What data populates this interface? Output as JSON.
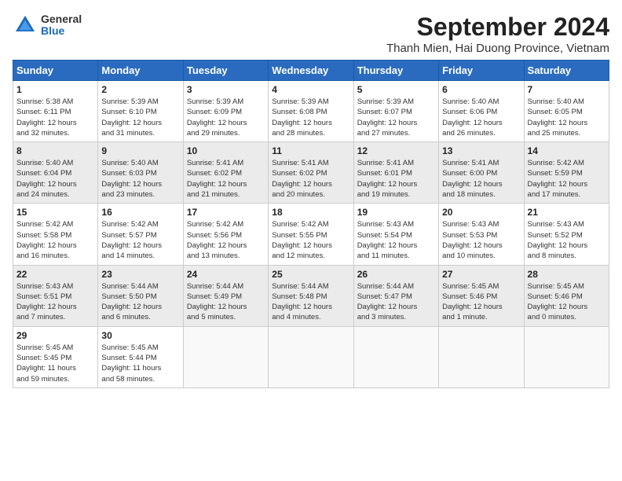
{
  "logo": {
    "general": "General",
    "blue": "Blue"
  },
  "title": "September 2024",
  "location": "Thanh Mien, Hai Duong Province, Vietnam",
  "days_header": [
    "Sunday",
    "Monday",
    "Tuesday",
    "Wednesday",
    "Thursday",
    "Friday",
    "Saturday"
  ],
  "weeks": [
    [
      {
        "num": "1",
        "lines": [
          "Sunrise: 5:38 AM",
          "Sunset: 6:11 PM",
          "Daylight: 12 hours",
          "and 32 minutes."
        ]
      },
      {
        "num": "2",
        "lines": [
          "Sunrise: 5:39 AM",
          "Sunset: 6:10 PM",
          "Daylight: 12 hours",
          "and 31 minutes."
        ]
      },
      {
        "num": "3",
        "lines": [
          "Sunrise: 5:39 AM",
          "Sunset: 6:09 PM",
          "Daylight: 12 hours",
          "and 29 minutes."
        ]
      },
      {
        "num": "4",
        "lines": [
          "Sunrise: 5:39 AM",
          "Sunset: 6:08 PM",
          "Daylight: 12 hours",
          "and 28 minutes."
        ]
      },
      {
        "num": "5",
        "lines": [
          "Sunrise: 5:39 AM",
          "Sunset: 6:07 PM",
          "Daylight: 12 hours",
          "and 27 minutes."
        ]
      },
      {
        "num": "6",
        "lines": [
          "Sunrise: 5:40 AM",
          "Sunset: 6:06 PM",
          "Daylight: 12 hours",
          "and 26 minutes."
        ]
      },
      {
        "num": "7",
        "lines": [
          "Sunrise: 5:40 AM",
          "Sunset: 6:05 PM",
          "Daylight: 12 hours",
          "and 25 minutes."
        ]
      }
    ],
    [
      {
        "num": "8",
        "lines": [
          "Sunrise: 5:40 AM",
          "Sunset: 6:04 PM",
          "Daylight: 12 hours",
          "and 24 minutes."
        ]
      },
      {
        "num": "9",
        "lines": [
          "Sunrise: 5:40 AM",
          "Sunset: 6:03 PM",
          "Daylight: 12 hours",
          "and 23 minutes."
        ]
      },
      {
        "num": "10",
        "lines": [
          "Sunrise: 5:41 AM",
          "Sunset: 6:02 PM",
          "Daylight: 12 hours",
          "and 21 minutes."
        ]
      },
      {
        "num": "11",
        "lines": [
          "Sunrise: 5:41 AM",
          "Sunset: 6:02 PM",
          "Daylight: 12 hours",
          "and 20 minutes."
        ]
      },
      {
        "num": "12",
        "lines": [
          "Sunrise: 5:41 AM",
          "Sunset: 6:01 PM",
          "Daylight: 12 hours",
          "and 19 minutes."
        ]
      },
      {
        "num": "13",
        "lines": [
          "Sunrise: 5:41 AM",
          "Sunset: 6:00 PM",
          "Daylight: 12 hours",
          "and 18 minutes."
        ]
      },
      {
        "num": "14",
        "lines": [
          "Sunrise: 5:42 AM",
          "Sunset: 5:59 PM",
          "Daylight: 12 hours",
          "and 17 minutes."
        ]
      }
    ],
    [
      {
        "num": "15",
        "lines": [
          "Sunrise: 5:42 AM",
          "Sunset: 5:58 PM",
          "Daylight: 12 hours",
          "and 16 minutes."
        ]
      },
      {
        "num": "16",
        "lines": [
          "Sunrise: 5:42 AM",
          "Sunset: 5:57 PM",
          "Daylight: 12 hours",
          "and 14 minutes."
        ]
      },
      {
        "num": "17",
        "lines": [
          "Sunrise: 5:42 AM",
          "Sunset: 5:56 PM",
          "Daylight: 12 hours",
          "and 13 minutes."
        ]
      },
      {
        "num": "18",
        "lines": [
          "Sunrise: 5:42 AM",
          "Sunset: 5:55 PM",
          "Daylight: 12 hours",
          "and 12 minutes."
        ]
      },
      {
        "num": "19",
        "lines": [
          "Sunrise: 5:43 AM",
          "Sunset: 5:54 PM",
          "Daylight: 12 hours",
          "and 11 minutes."
        ]
      },
      {
        "num": "20",
        "lines": [
          "Sunrise: 5:43 AM",
          "Sunset: 5:53 PM",
          "Daylight: 12 hours",
          "and 10 minutes."
        ]
      },
      {
        "num": "21",
        "lines": [
          "Sunrise: 5:43 AM",
          "Sunset: 5:52 PM",
          "Daylight: 12 hours",
          "and 8 minutes."
        ]
      }
    ],
    [
      {
        "num": "22",
        "lines": [
          "Sunrise: 5:43 AM",
          "Sunset: 5:51 PM",
          "Daylight: 12 hours",
          "and 7 minutes."
        ]
      },
      {
        "num": "23",
        "lines": [
          "Sunrise: 5:44 AM",
          "Sunset: 5:50 PM",
          "Daylight: 12 hours",
          "and 6 minutes."
        ]
      },
      {
        "num": "24",
        "lines": [
          "Sunrise: 5:44 AM",
          "Sunset: 5:49 PM",
          "Daylight: 12 hours",
          "and 5 minutes."
        ]
      },
      {
        "num": "25",
        "lines": [
          "Sunrise: 5:44 AM",
          "Sunset: 5:48 PM",
          "Daylight: 12 hours",
          "and 4 minutes."
        ]
      },
      {
        "num": "26",
        "lines": [
          "Sunrise: 5:44 AM",
          "Sunset: 5:47 PM",
          "Daylight: 12 hours",
          "and 3 minutes."
        ]
      },
      {
        "num": "27",
        "lines": [
          "Sunrise: 5:45 AM",
          "Sunset: 5:46 PM",
          "Daylight: 12 hours",
          "and 1 minute."
        ]
      },
      {
        "num": "28",
        "lines": [
          "Sunrise: 5:45 AM",
          "Sunset: 5:46 PM",
          "Daylight: 12 hours",
          "and 0 minutes."
        ]
      }
    ],
    [
      {
        "num": "29",
        "lines": [
          "Sunrise: 5:45 AM",
          "Sunset: 5:45 PM",
          "Daylight: 11 hours",
          "and 59 minutes."
        ]
      },
      {
        "num": "30",
        "lines": [
          "Sunrise: 5:45 AM",
          "Sunset: 5:44 PM",
          "Daylight: 11 hours",
          "and 58 minutes."
        ]
      },
      {
        "num": "",
        "lines": []
      },
      {
        "num": "",
        "lines": []
      },
      {
        "num": "",
        "lines": []
      },
      {
        "num": "",
        "lines": []
      },
      {
        "num": "",
        "lines": []
      }
    ]
  ]
}
